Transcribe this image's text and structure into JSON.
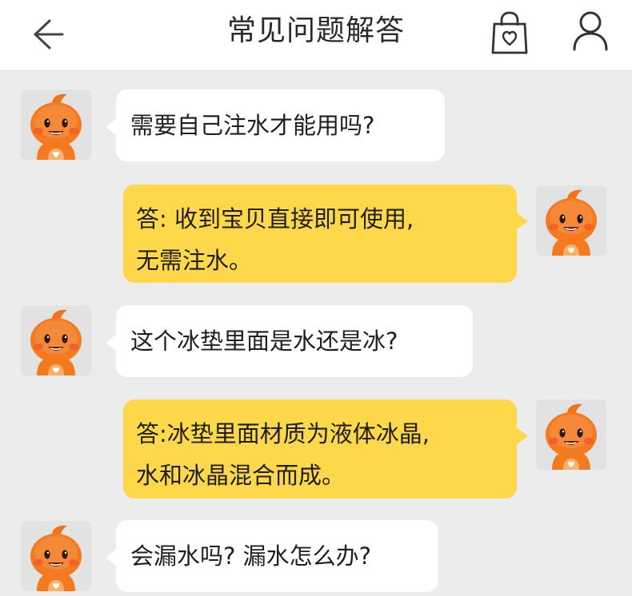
{
  "header": {
    "title": "常见问题解答",
    "back_icon": "back-arrow-icon",
    "bag_icon": "shopping-bag-heart-icon",
    "user_icon": "user-profile-icon"
  },
  "colors": {
    "answer_bubble": "#fcd84a",
    "question_bubble": "#ffffff",
    "background": "#ececec",
    "mascot": "#f47a1f"
  },
  "messages": [
    {
      "role": "question",
      "text": "需要自己注水才能用吗?"
    },
    {
      "role": "answer",
      "lines": [
        "答: 收到宝贝直接即可使用,",
        "无需注水。"
      ]
    },
    {
      "role": "question",
      "text": "这个冰垫里面是水还是冰?"
    },
    {
      "role": "answer",
      "lines": [
        "答:冰垫里面材质为液体冰晶,",
        "水和冰晶混合而成。"
      ]
    },
    {
      "role": "question",
      "text": "会漏水吗? 漏水怎么办?"
    }
  ]
}
